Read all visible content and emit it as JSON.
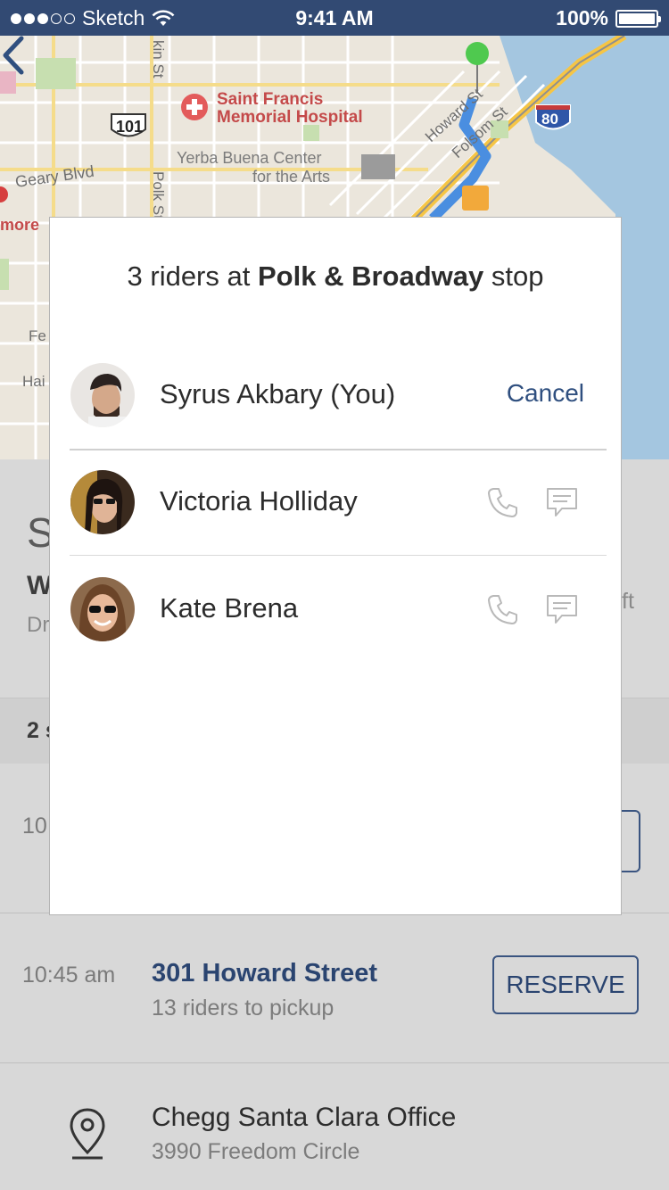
{
  "status_bar": {
    "carrier": "Sketch",
    "time": "9:41 AM",
    "battery": "100%"
  },
  "map": {
    "labels": {
      "hospital": "Saint Francis\nMemorial Hospital",
      "yerba": "Yerba Buena Center\nfor the Arts",
      "geary": "Geary Blvd",
      "howard": "Howard St",
      "folsom": "Folsom St",
      "polk": "Polk St",
      "larkin": "kin St",
      "hwy101": "101",
      "hwy80": "80",
      "more": "more",
      "fe": "Fe",
      "hai": "Hai"
    }
  },
  "modal": {
    "heading_count": "3 riders at",
    "heading_stop": "Polk & Broadway",
    "heading_suffix": "stop",
    "riders": [
      {
        "name": "Syrus Akbary (You)",
        "action": "Cancel"
      },
      {
        "name": "Victoria Holliday"
      },
      {
        "name": "Kate Brena"
      }
    ]
  },
  "background": {
    "partial_left_s": "S",
    "partial_left_w": "W",
    "partial_left_dr": "Dr",
    "partial_right_ft": "ft",
    "section_partial": "2 s",
    "row1_time_partial": "10",
    "row2": {
      "time": "10:45 am",
      "title": "301 Howard Street",
      "subtitle": "13 riders to pickup",
      "button": "RESERVE"
    },
    "destination": {
      "title": "Chegg Santa Clara Office",
      "subtitle": "3990 Freedom Circle"
    }
  },
  "colors": {
    "status_bar": "#324a73",
    "accent": "#2f4f7f",
    "modal_bg": "#ffffff",
    "underlay": "#d8d8d8"
  }
}
